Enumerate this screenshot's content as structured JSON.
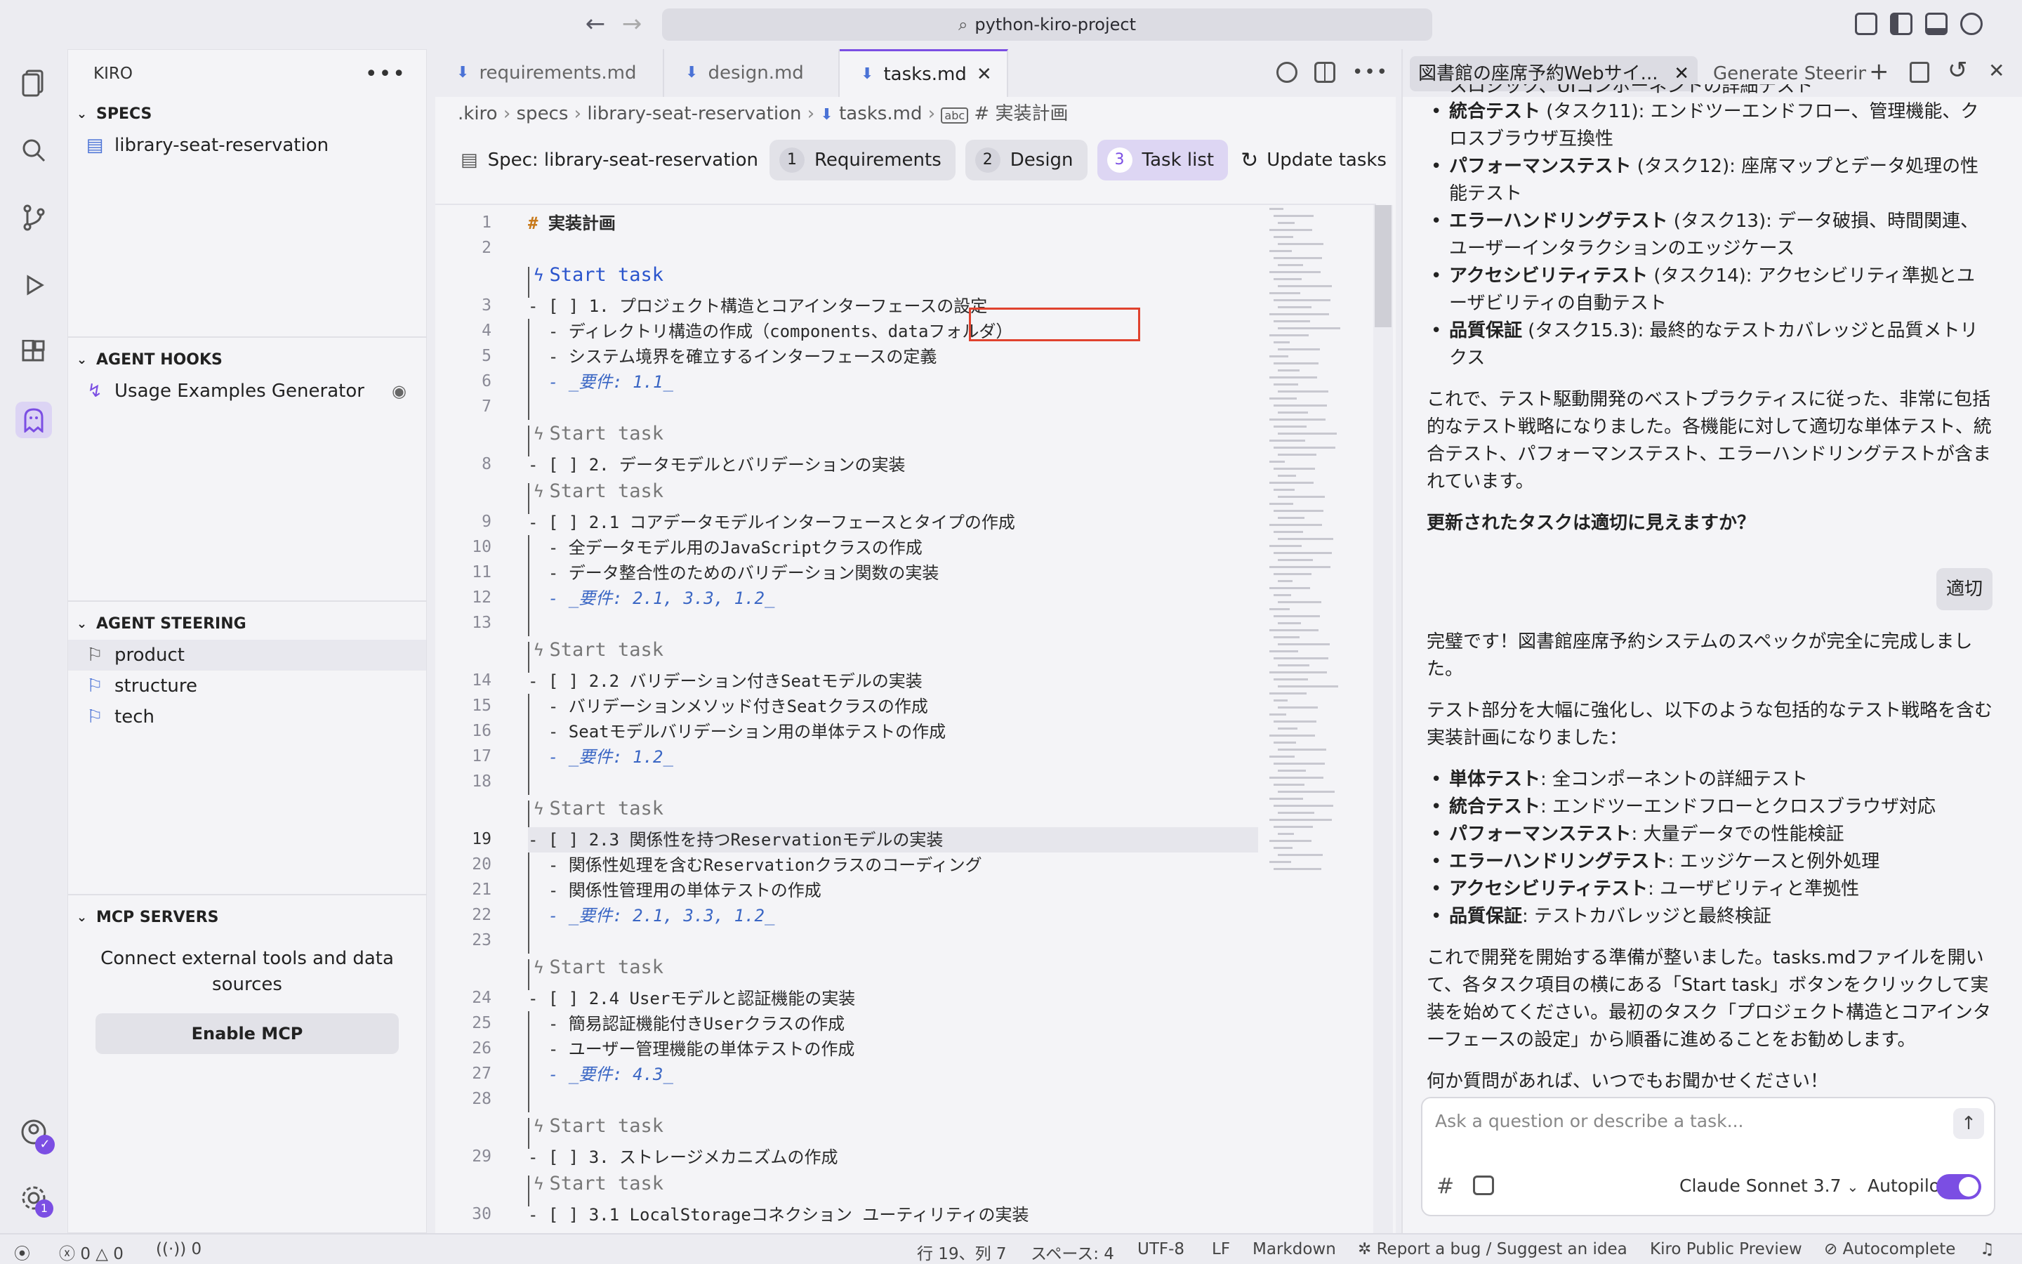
{
  "window": {
    "search_text": "python-kiro-project"
  },
  "sidebar": {
    "title": "KIRO",
    "sections": {
      "specs": {
        "title": "SPECS",
        "items": [
          "library-seat-reservation"
        ]
      },
      "hooks": {
        "title": "AGENT HOOKS",
        "items": [
          "Usage Examples Generator"
        ]
      },
      "steering": {
        "title": "AGENT STEERING",
        "items": [
          "product",
          "structure",
          "tech"
        ]
      },
      "mcp": {
        "title": "MCP SERVERS",
        "description": "Connect external tools and data sources",
        "button": "Enable MCP"
      }
    }
  },
  "activity": {
    "badge": "1"
  },
  "editor": {
    "tabs": [
      "requirements.md",
      "design.md",
      "tasks.md"
    ],
    "breadcrumb": {
      "root": ".kiro",
      "specs": "specs",
      "folder": "library-seat-reservation",
      "file": "tasks.md",
      "symbol": "# 実装計画"
    },
    "spec_bar": {
      "label": "Spec: library-seat-reservation",
      "steps": [
        {
          "num": "1",
          "label": "Requirements"
        },
        {
          "num": "2",
          "label": "Design"
        },
        {
          "num": "3",
          "label": "Task list"
        }
      ],
      "update": "Update tasks"
    },
    "lens_label": "Start task",
    "lines": [
      {
        "n": "1",
        "text": "実装計画",
        "hash": "#"
      },
      {
        "n": "2",
        "text": ""
      },
      {
        "n": "3",
        "text": "- [ ] 1. プロジェクト構造とコアインターフェースの設定"
      },
      {
        "n": "4",
        "text": "  - ディレクトリ構造の作成（components、dataフォルダ）"
      },
      {
        "n": "5",
        "text": "  - システム境界を確立するインターフェースの定義"
      },
      {
        "n": "6",
        "text": "  - _要件: 1.1_"
      },
      {
        "n": "7",
        "text": ""
      },
      {
        "n": "8",
        "text": "- [ ] 2. データモデルとバリデーションの実装"
      },
      {
        "n": "9",
        "text": "- [ ] 2.1 コアデータモデルインターフェースとタイプの作成"
      },
      {
        "n": "10",
        "text": "  - 全データモデル用のJavaScriptクラスの作成"
      },
      {
        "n": "11",
        "text": "  - データ整合性のためのバリデーション関数の実装"
      },
      {
        "n": "12",
        "text": "  - _要件: 2.1, 3.3, 1.2_"
      },
      {
        "n": "13",
        "text": ""
      },
      {
        "n": "14",
        "text": "- [ ] 2.2 バリデーション付きSeatモデルの実装"
      },
      {
        "n": "15",
        "text": "  - バリデーションメソッド付きSeatクラスの作成"
      },
      {
        "n": "16",
        "text": "  - Seatモデルバリデーション用の単体テストの作成"
      },
      {
        "n": "17",
        "text": "  - _要件: 1.2_"
      },
      {
        "n": "18",
        "text": ""
      },
      {
        "n": "19",
        "text": "- [ ] 2.3 関係性を持つReservationモデルの実装"
      },
      {
        "n": "20",
        "text": "  - 関係性処理を含むReservationクラスのコーディング"
      },
      {
        "n": "21",
        "text": "  - 関係性管理用の単体テストの作成"
      },
      {
        "n": "22",
        "text": "  - _要件: 2.1, 3.3, 1.2_"
      },
      {
        "n": "23",
        "text": ""
      },
      {
        "n": "24",
        "text": "- [ ] 2.4 Userモデルと認証機能の実装"
      },
      {
        "n": "25",
        "text": "  - 簡易認証機能付きUserクラスの作成"
      },
      {
        "n": "26",
        "text": "  - ユーザー管理機能の単体テストの作成"
      },
      {
        "n": "27",
        "text": "  - _要件: 4.3_"
      },
      {
        "n": "28",
        "text": ""
      },
      {
        "n": "29",
        "text": "- [ ] 3. ストレージメカニズムの作成"
      },
      {
        "n": "30",
        "text": "- [ ] 3.1 LocalStorageコネクション ユーティリティの実装"
      }
    ]
  },
  "chat": {
    "tabs": [
      "図書館の座席予約Webサイ...",
      "Generate Steering"
    ],
    "top_partial": "スロジック、UIコンポーネントの詳細テスト",
    "bullets1": [
      {
        "b": "統合テスト",
        "t": " (タスク11): エンドツーエンドフロー、管理機能、クロスブラウザ互換性"
      },
      {
        "b": "パフォーマンステスト",
        "t": " (タスク12): 座席マップとデータ処理の性能テスト"
      },
      {
        "b": "エラーハンドリングテスト",
        "t": " (タスク13): データ破損、時間関連、ユーザーインタラクションのエッジケース"
      },
      {
        "b": "アクセシビリティテスト",
        "t": " (タスク14): アクセシビリティ準拠とユーザビリティの自動テスト"
      },
      {
        "b": "品質保証",
        "t": " (タスク15.3): 最終的なテストカバレッジと品質メトリクス"
      }
    ],
    "para1": "これで、テスト駆動開発のベストプラクティスに従った、非常に包括的なテスト戦略になりました。各機能に対して適切な単体テスト、統合テスト、パフォーマンステスト、エラーハンドリングテストが含まれています。",
    "question": "更新されたタスクは適切に見えますか？",
    "user_reply": "適切",
    "para2": "完璧です！図書館座席予約システムのスペックが完全に完成しました。",
    "para3": "テスト部分を大幅に強化し、以下のような包括的なテスト戦略を含む実装計画になりました：",
    "bullets2": [
      {
        "b": "単体テスト",
        "t": ": 全コンポーネントの詳細テスト"
      },
      {
        "b": "統合テスト",
        "t": ": エンドツーエンドフローとクロスブラウザ対応"
      },
      {
        "b": "パフォーマンステスト",
        "t": ": 大量データでの性能検証"
      },
      {
        "b": "エラーハンドリングテスト",
        "t": ": エッジケースと例外処理"
      },
      {
        "b": "アクセシビリティテスト",
        "t": ": ユーザビリティと準拠性"
      },
      {
        "b": "品質保証",
        "t": ": テストカバレッジと最終検証"
      }
    ],
    "para4": "これで開発を開始する準備が整いました。tasks.mdファイルを開いて、各タスク項目の横にある「Start task」ボタンをクリックして実装を始めてください。最初のタスク「プロジェクト構造とコアインターフェースの設定」から順番に進めることをお勧めします。",
    "para5": "何か質問があれば、いつでもお聞かせください！",
    "input_placeholder": "Ask a question or describe a task...",
    "model": "Claude Sonnet 3.7",
    "autopilot": "Autopilot"
  },
  "status": {
    "errors": "0",
    "warnings": "0",
    "ports": "0",
    "position": "行 19、列 7",
    "spaces": "スペース: 4",
    "encoding": "UTF-8",
    "eol": "LF",
    "language": "Markdown",
    "report": "Report a bug / Suggest an idea",
    "preview": "Kiro Public Preview",
    "autocomplete": "Autocomplete"
  }
}
